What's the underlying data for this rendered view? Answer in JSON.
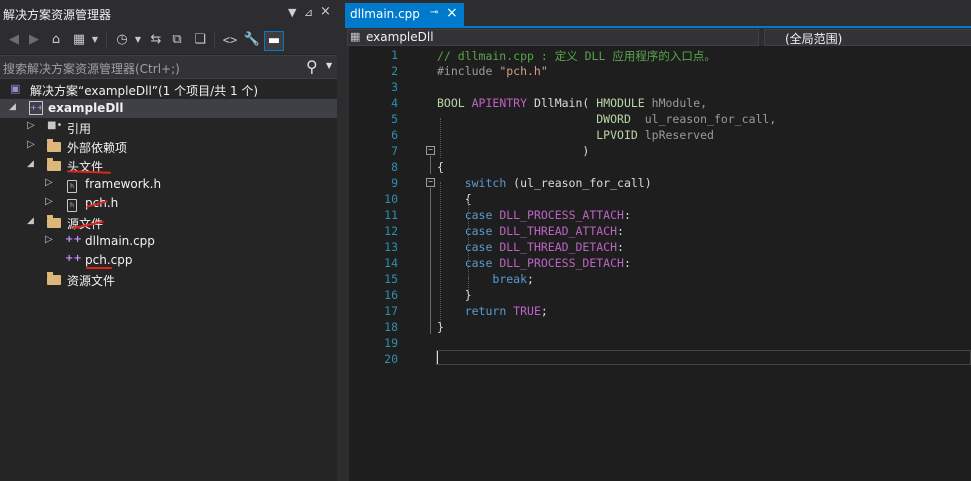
{
  "colors": {
    "accent": "#007acc",
    "selection_row": "#3f3f46",
    "annotation_red": "#e2231a",
    "comment": "#57a64a",
    "keyword": "#569cd6",
    "macro": "#bd63c5",
    "type": "#b8d7a3",
    "line_number": "#2b91af"
  },
  "solution_explorer": {
    "title": "解决方案资源管理器",
    "title_buttons": [
      "▼",
      "⊿",
      "×"
    ],
    "search_placeholder": "搜索解决方案资源管理器(Ctrl+;)",
    "toolbar_icons": [
      "back-icon",
      "forward-icon",
      "home-icon",
      "switch-views-icon",
      "pending-changes-icon",
      "sync-icon",
      "collapse-all-icon",
      "show-all-files-icon",
      "code-view-icon",
      "properties-icon",
      "preview-icon"
    ],
    "tree": [
      {
        "label": "解决方案“exampleDll”(1 个项目/共 1 个)",
        "icon": "solution-icon",
        "level": 0,
        "expander": "",
        "bold": false
      },
      {
        "label": "exampleDll",
        "icon": "cpp-project-icon",
        "level": 0,
        "expander": "◢",
        "bold": true
      },
      {
        "label": "引用",
        "icon": "references-icon",
        "level": 1,
        "expander": "▷",
        "bold": false
      },
      {
        "label": "外部依赖项",
        "icon": "external-deps-icon",
        "level": 1,
        "expander": "▷",
        "bold": false
      },
      {
        "label": "头文件",
        "icon": "folder-icon",
        "level": 1,
        "expander": "◢",
        "bold": false
      },
      {
        "label": "framework.h",
        "icon": "header-file-icon",
        "level": 2,
        "expander": "▷",
        "bold": false
      },
      {
        "label": "pch.h",
        "icon": "header-file-icon",
        "level": 2,
        "expander": "▷",
        "bold": false
      },
      {
        "label": "源文件",
        "icon": "folder-icon",
        "level": 1,
        "expander": "◢",
        "bold": false
      },
      {
        "label": "dllmain.cpp",
        "icon": "cpp-file-icon",
        "level": 2,
        "expander": "▷",
        "bold": false
      },
      {
        "label": "pch.cpp",
        "icon": "cpp-file-icon",
        "level": 2,
        "expander": "",
        "bold": false
      },
      {
        "label": "资源文件",
        "icon": "folder-icon",
        "level": 1,
        "expander": "",
        "bold": false
      }
    ]
  },
  "editor": {
    "tab_title": "dllmain.cpp",
    "tab_pin": "⊸",
    "tab_close": "×",
    "nav_project": "exampleDll",
    "nav_scope": "(全局范围)",
    "lines": [
      [
        {
          "t": "// dllmain.cpp : 定义 DLL 应用程序的入口点。",
          "c": "cm"
        }
      ],
      [
        {
          "t": "#include ",
          "c": "pp"
        },
        {
          "t": "\"pch.h\"",
          "c": "str"
        }
      ],
      [],
      [
        {
          "t": "BOOL ",
          "c": "ty"
        },
        {
          "t": "APIENTRY ",
          "c": "mac"
        },
        {
          "t": "DllMain",
          "c": "fn"
        },
        {
          "t": "( ",
          "c": "pl"
        },
        {
          "t": "HMODULE ",
          "c": "ty"
        },
        {
          "t": "hModule,",
          "c": "pr"
        }
      ],
      [
        {
          "t": "                       ",
          "c": "pl"
        },
        {
          "t": "DWORD  ",
          "c": "ty"
        },
        {
          "t": "ul_reason_for_call,",
          "c": "pr"
        }
      ],
      [
        {
          "t": "                       ",
          "c": "pl"
        },
        {
          "t": "LPVOID ",
          "c": "ty"
        },
        {
          "t": "lpReserved",
          "c": "pr"
        }
      ],
      [
        {
          "t": "                     )",
          "c": "pl"
        }
      ],
      [
        {
          "t": "{",
          "c": "pl"
        }
      ],
      [
        {
          "t": "    ",
          "c": "pl"
        },
        {
          "t": "switch",
          "c": "kw"
        },
        {
          "t": " (ul_reason_for_call)",
          "c": "pl"
        }
      ],
      [
        {
          "t": "    {",
          "c": "pl"
        }
      ],
      [
        {
          "t": "    ",
          "c": "pl"
        },
        {
          "t": "case ",
          "c": "kw"
        },
        {
          "t": "DLL_PROCESS_ATTACH",
          "c": "mac"
        },
        {
          "t": ":",
          "c": "pl"
        }
      ],
      [
        {
          "t": "    ",
          "c": "pl"
        },
        {
          "t": "case ",
          "c": "kw"
        },
        {
          "t": "DLL_THREAD_ATTACH",
          "c": "mac"
        },
        {
          "t": ":",
          "c": "pl"
        }
      ],
      [
        {
          "t": "    ",
          "c": "pl"
        },
        {
          "t": "case ",
          "c": "kw"
        },
        {
          "t": "DLL_THREAD_DETACH",
          "c": "mac"
        },
        {
          "t": ":",
          "c": "pl"
        }
      ],
      [
        {
          "t": "    ",
          "c": "pl"
        },
        {
          "t": "case ",
          "c": "kw"
        },
        {
          "t": "DLL_PROCESS_DETACH",
          "c": "mac"
        },
        {
          "t": ":",
          "c": "pl"
        }
      ],
      [
        {
          "t": "        ",
          "c": "pl"
        },
        {
          "t": "break",
          "c": "kw"
        },
        {
          "t": ";",
          "c": "pl"
        }
      ],
      [
        {
          "t": "    }",
          "c": "pl"
        }
      ],
      [
        {
          "t": "    ",
          "c": "pl"
        },
        {
          "t": "return ",
          "c": "kw"
        },
        {
          "t": "TRUE",
          "c": "mac"
        },
        {
          "t": ";",
          "c": "pl"
        }
      ],
      [
        {
          "t": "}",
          "c": "pl"
        }
      ],
      [],
      []
    ]
  }
}
